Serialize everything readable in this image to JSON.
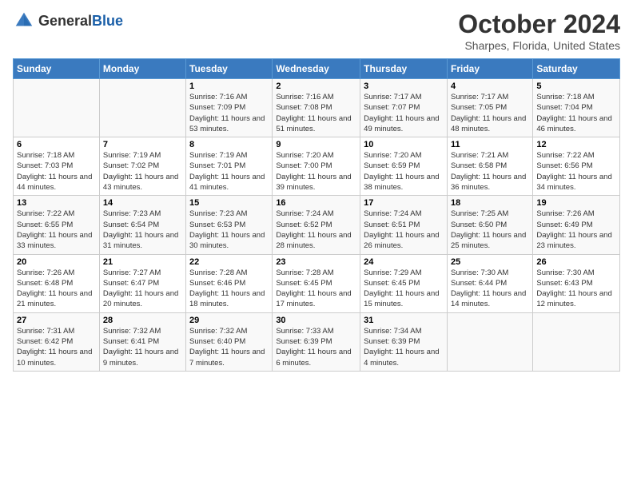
{
  "header": {
    "logo_general": "General",
    "logo_blue": "Blue",
    "month_title": "October 2024",
    "location": "Sharpes, Florida, United States"
  },
  "weekdays": [
    "Sunday",
    "Monday",
    "Tuesday",
    "Wednesday",
    "Thursday",
    "Friday",
    "Saturday"
  ],
  "weeks": [
    [
      {
        "day": "",
        "sunrise": "",
        "sunset": "",
        "daylight": ""
      },
      {
        "day": "",
        "sunrise": "",
        "sunset": "",
        "daylight": ""
      },
      {
        "day": "1",
        "sunrise": "Sunrise: 7:16 AM",
        "sunset": "Sunset: 7:09 PM",
        "daylight": "Daylight: 11 hours and 53 minutes."
      },
      {
        "day": "2",
        "sunrise": "Sunrise: 7:16 AM",
        "sunset": "Sunset: 7:08 PM",
        "daylight": "Daylight: 11 hours and 51 minutes."
      },
      {
        "day": "3",
        "sunrise": "Sunrise: 7:17 AM",
        "sunset": "Sunset: 7:07 PM",
        "daylight": "Daylight: 11 hours and 49 minutes."
      },
      {
        "day": "4",
        "sunrise": "Sunrise: 7:17 AM",
        "sunset": "Sunset: 7:05 PM",
        "daylight": "Daylight: 11 hours and 48 minutes."
      },
      {
        "day": "5",
        "sunrise": "Sunrise: 7:18 AM",
        "sunset": "Sunset: 7:04 PM",
        "daylight": "Daylight: 11 hours and 46 minutes."
      }
    ],
    [
      {
        "day": "6",
        "sunrise": "Sunrise: 7:18 AM",
        "sunset": "Sunset: 7:03 PM",
        "daylight": "Daylight: 11 hours and 44 minutes."
      },
      {
        "day": "7",
        "sunrise": "Sunrise: 7:19 AM",
        "sunset": "Sunset: 7:02 PM",
        "daylight": "Daylight: 11 hours and 43 minutes."
      },
      {
        "day": "8",
        "sunrise": "Sunrise: 7:19 AM",
        "sunset": "Sunset: 7:01 PM",
        "daylight": "Daylight: 11 hours and 41 minutes."
      },
      {
        "day": "9",
        "sunrise": "Sunrise: 7:20 AM",
        "sunset": "Sunset: 7:00 PM",
        "daylight": "Daylight: 11 hours and 39 minutes."
      },
      {
        "day": "10",
        "sunrise": "Sunrise: 7:20 AM",
        "sunset": "Sunset: 6:59 PM",
        "daylight": "Daylight: 11 hours and 38 minutes."
      },
      {
        "day": "11",
        "sunrise": "Sunrise: 7:21 AM",
        "sunset": "Sunset: 6:58 PM",
        "daylight": "Daylight: 11 hours and 36 minutes."
      },
      {
        "day": "12",
        "sunrise": "Sunrise: 7:22 AM",
        "sunset": "Sunset: 6:56 PM",
        "daylight": "Daylight: 11 hours and 34 minutes."
      }
    ],
    [
      {
        "day": "13",
        "sunrise": "Sunrise: 7:22 AM",
        "sunset": "Sunset: 6:55 PM",
        "daylight": "Daylight: 11 hours and 33 minutes."
      },
      {
        "day": "14",
        "sunrise": "Sunrise: 7:23 AM",
        "sunset": "Sunset: 6:54 PM",
        "daylight": "Daylight: 11 hours and 31 minutes."
      },
      {
        "day": "15",
        "sunrise": "Sunrise: 7:23 AM",
        "sunset": "Sunset: 6:53 PM",
        "daylight": "Daylight: 11 hours and 30 minutes."
      },
      {
        "day": "16",
        "sunrise": "Sunrise: 7:24 AM",
        "sunset": "Sunset: 6:52 PM",
        "daylight": "Daylight: 11 hours and 28 minutes."
      },
      {
        "day": "17",
        "sunrise": "Sunrise: 7:24 AM",
        "sunset": "Sunset: 6:51 PM",
        "daylight": "Daylight: 11 hours and 26 minutes."
      },
      {
        "day": "18",
        "sunrise": "Sunrise: 7:25 AM",
        "sunset": "Sunset: 6:50 PM",
        "daylight": "Daylight: 11 hours and 25 minutes."
      },
      {
        "day": "19",
        "sunrise": "Sunrise: 7:26 AM",
        "sunset": "Sunset: 6:49 PM",
        "daylight": "Daylight: 11 hours and 23 minutes."
      }
    ],
    [
      {
        "day": "20",
        "sunrise": "Sunrise: 7:26 AM",
        "sunset": "Sunset: 6:48 PM",
        "daylight": "Daylight: 11 hours and 21 minutes."
      },
      {
        "day": "21",
        "sunrise": "Sunrise: 7:27 AM",
        "sunset": "Sunset: 6:47 PM",
        "daylight": "Daylight: 11 hours and 20 minutes."
      },
      {
        "day": "22",
        "sunrise": "Sunrise: 7:28 AM",
        "sunset": "Sunset: 6:46 PM",
        "daylight": "Daylight: 11 hours and 18 minutes."
      },
      {
        "day": "23",
        "sunrise": "Sunrise: 7:28 AM",
        "sunset": "Sunset: 6:45 PM",
        "daylight": "Daylight: 11 hours and 17 minutes."
      },
      {
        "day": "24",
        "sunrise": "Sunrise: 7:29 AM",
        "sunset": "Sunset: 6:45 PM",
        "daylight": "Daylight: 11 hours and 15 minutes."
      },
      {
        "day": "25",
        "sunrise": "Sunrise: 7:30 AM",
        "sunset": "Sunset: 6:44 PM",
        "daylight": "Daylight: 11 hours and 14 minutes."
      },
      {
        "day": "26",
        "sunrise": "Sunrise: 7:30 AM",
        "sunset": "Sunset: 6:43 PM",
        "daylight": "Daylight: 11 hours and 12 minutes."
      }
    ],
    [
      {
        "day": "27",
        "sunrise": "Sunrise: 7:31 AM",
        "sunset": "Sunset: 6:42 PM",
        "daylight": "Daylight: 11 hours and 10 minutes."
      },
      {
        "day": "28",
        "sunrise": "Sunrise: 7:32 AM",
        "sunset": "Sunset: 6:41 PM",
        "daylight": "Daylight: 11 hours and 9 minutes."
      },
      {
        "day": "29",
        "sunrise": "Sunrise: 7:32 AM",
        "sunset": "Sunset: 6:40 PM",
        "daylight": "Daylight: 11 hours and 7 minutes."
      },
      {
        "day": "30",
        "sunrise": "Sunrise: 7:33 AM",
        "sunset": "Sunset: 6:39 PM",
        "daylight": "Daylight: 11 hours and 6 minutes."
      },
      {
        "day": "31",
        "sunrise": "Sunrise: 7:34 AM",
        "sunset": "Sunset: 6:39 PM",
        "daylight": "Daylight: 11 hours and 4 minutes."
      },
      {
        "day": "",
        "sunrise": "",
        "sunset": "",
        "daylight": ""
      },
      {
        "day": "",
        "sunrise": "",
        "sunset": "",
        "daylight": ""
      }
    ]
  ]
}
